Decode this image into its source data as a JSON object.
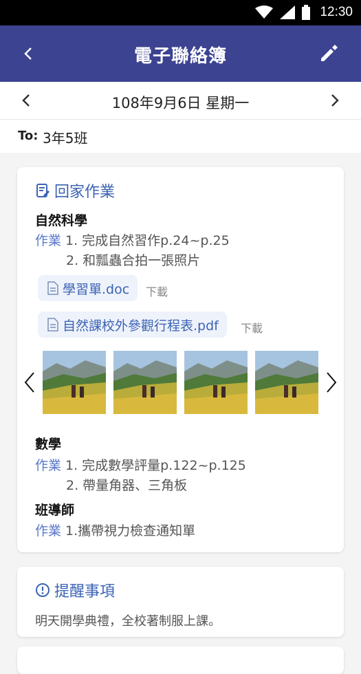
{
  "status_bar": {
    "time": "12:30",
    "icons": [
      "wifi-icon",
      "signal-icon",
      "battery-icon"
    ]
  },
  "app_bar": {
    "title": "電子聯絡簿",
    "back_icon": "back-icon",
    "edit_icon": "edit-icon"
  },
  "date_bar": {
    "date": "108年9月6日 星期一"
  },
  "to_bar": {
    "label": "To:",
    "value": "3年5班"
  },
  "homework": {
    "heading": "回家作業",
    "subjects": [
      {
        "name": "自然科學",
        "tag": "作業",
        "items": [
          "1. 完成自然習作p.24~p.25",
          "2. 和瓢蟲合拍一張照片"
        ],
        "attachments": [
          {
            "name": "學習單.doc",
            "download": "下載"
          },
          {
            "name": "自然課校外參觀行程表.pdf",
            "download": "下載"
          }
        ]
      },
      {
        "name": "數學",
        "tag": "作業",
        "items": [
          "1. 完成數學評量p.122~p.125",
          "2. 帶量角器、三角板"
        ]
      },
      {
        "name": "班導師",
        "tag": "作業",
        "items": [
          "1.攜帶視力檢查通知單"
        ]
      }
    ]
  },
  "reminder": {
    "heading": "提醒事項",
    "text": "明天開學典禮，全校著制服上課。"
  },
  "colors": {
    "app_bar": "#3c4391",
    "accent": "#3c63b4",
    "tag": "#5a78c8",
    "background": "#f4f4f4"
  }
}
